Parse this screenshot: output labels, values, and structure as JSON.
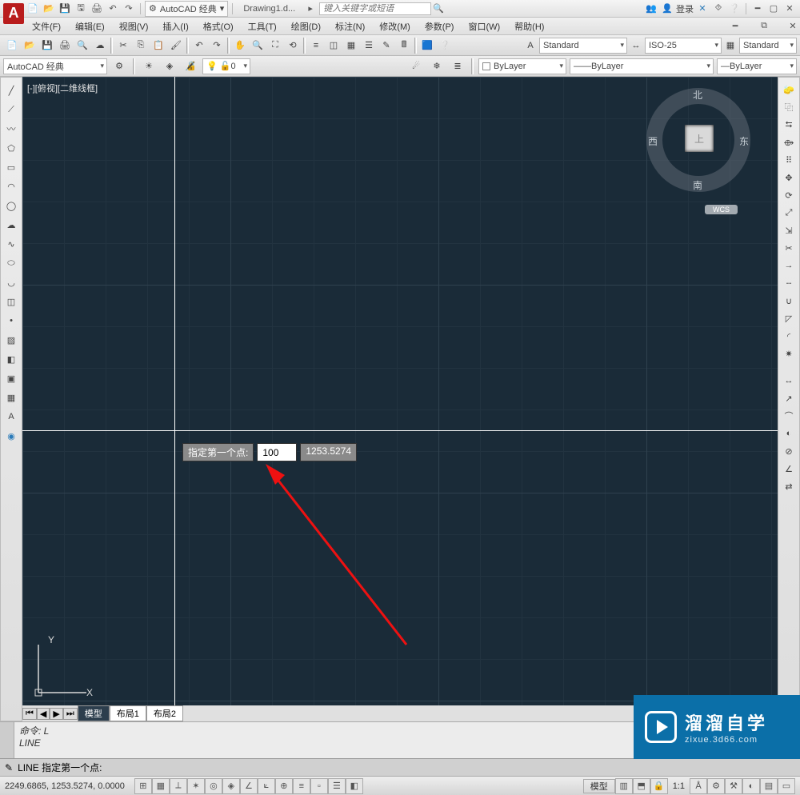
{
  "title": {
    "workspace_label": "AutoCAD 经典",
    "doc_name": "Drawing1.d...",
    "search_placeholder": "键入关键字或短语",
    "login": "登录"
  },
  "menubar": [
    "文件(F)",
    "编辑(E)",
    "视图(V)",
    "插入(I)",
    "格式(O)",
    "工具(T)",
    "绘图(D)",
    "标注(N)",
    "修改(M)",
    "参数(P)",
    "窗口(W)",
    "帮助(H)"
  ],
  "propbar": {
    "workspace": "AutoCAD 经典",
    "layer": "0",
    "bylayer1": "ByLayer",
    "bylayer2": "ByLayer",
    "bylayer3": "ByLayer",
    "std1": "Standard",
    "iso": "ISO-25",
    "std2": "Standard"
  },
  "canvas": {
    "view_label": "[-][俯视][二维线框]",
    "cube": {
      "n": "北",
      "s": "南",
      "e": "东",
      "w": "西",
      "top": "上",
      "wcs": "WCS"
    },
    "prompt_label": "指定第一个点:",
    "prompt_x": "100",
    "prompt_y": "1253.5274",
    "ucs_x": "X",
    "ucs_y": "Y"
  },
  "tabs": {
    "model": "模型",
    "layout1": "布局1",
    "layout2": "布局2"
  },
  "cmd": {
    "hist1": "命令: L",
    "hist2": "LINE",
    "prompt": "LINE 指定第一个点:"
  },
  "status": {
    "coords": "2249.6865, 1253.5274, 0.0000",
    "tab": "模型",
    "scale": "1:1"
  },
  "watermark": {
    "brand": "溜溜自学",
    "url": "zixue.3d66.com"
  }
}
